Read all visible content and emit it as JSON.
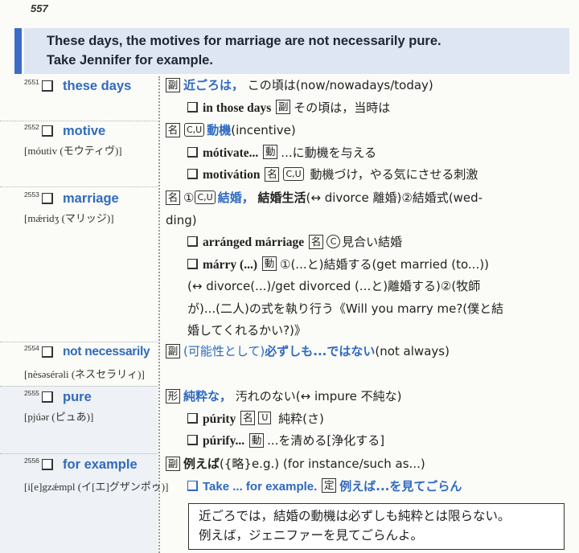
{
  "page": {
    "number": "557"
  },
  "header": {
    "line1": "These days, the motives for marriage are not necessarily pure.",
    "line2": "Take Jennifer for example."
  },
  "entries": [
    {
      "number": "2551",
      "headword": "these days",
      "lines": [
        [
          "副",
          "近ごろは，",
          "この頃は(now/nowadays/today)"
        ],
        [
          "in those days",
          "副",
          "その頃は，当時は"
        ]
      ]
    },
    {
      "number": "2552",
      "headword": "motive",
      "pron": "[móutiv (モウティヴ)]",
      "lines": [
        [
          "名",
          "C,U",
          "動機",
          "(incentive)"
        ],
        [
          "mótivate...",
          "動",
          "...に動機を与える"
        ],
        [
          "motivátion",
          "名",
          "C,U",
          "動機づけ，やる気にさせる刺激"
        ]
      ]
    },
    {
      "number": "2553",
      "headword": "marriage",
      "pron": "[mǽridʒ (マリッジ)]",
      "lines": [
        [
          "名",
          "①",
          "C,U",
          "結婚，",
          "結婚生活",
          "(↔ divorce 離婚)②結婚式(wed-"
        ],
        [
          "ding)"
        ],
        [
          "arránged márriage",
          "名",
          "C",
          "見合い結婚"
        ],
        [
          "márry (...)",
          "動",
          "①(...と)結婚する(get married (to...))"
        ],
        [
          "(↔ divorce(...)/get  divorced (...と)離婚する)②(牧師"
        ],
        [
          "が)...(二人)の式を執り行う《Will you marry me?(僕と結"
        ],
        [
          "婚してくれるかい?)》"
        ]
      ]
    },
    {
      "number": "2554",
      "headword": "not necessarily",
      "pron": "[nèsəsérəli (ネスセラリィ)]",
      "lines": [
        [
          "副",
          "(可能性として)",
          "必ずしも...ではない",
          "(not always)"
        ]
      ]
    },
    {
      "number": "2555",
      "headword": "pure",
      "pron": "[pjúər (ピュあ)]",
      "lines": [
        [
          "形",
          "純粋な，",
          "汚れのない(↔ impure 不純な)"
        ],
        [
          "púrity",
          "名",
          "U",
          "純粋(さ)"
        ],
        [
          "púrify...",
          "動",
          "...を清める[浄化する]"
        ]
      ]
    },
    {
      "number": "2556",
      "headword": "for example",
      "pron": "[i[e]gzǽmpl (イ[エ]グザンポゥ)]",
      "lines": [
        [
          "副",
          "例えば",
          "({略}e.g.) (for instance/such as...)"
        ],
        [
          "Take ... for example.",
          "定",
          "例えば...を見てごらん"
        ]
      ]
    }
  ],
  "translation": {
    "line1": "近ごろでは，結婚の動機は必ずしも純粋とは限らない。",
    "line2": "例えば，ジェニファーを見てごらんよ。"
  },
  "colors": {
    "accent": "#2f6ac0",
    "header_bar": "#3d6cc6",
    "header_bg": "#dde6f2"
  }
}
